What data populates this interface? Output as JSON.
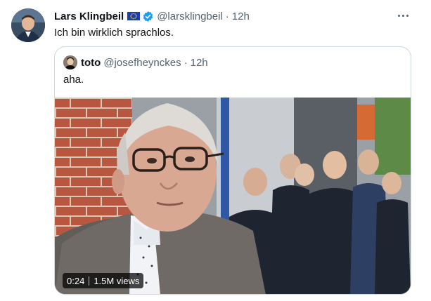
{
  "tweet": {
    "author": {
      "display_name": "Lars Klingbeil",
      "handle": "@larsklingbeil",
      "time": "12h",
      "flag_icon": "eu-flag-icon",
      "verified_icon": "verified-badge-icon",
      "verified_color": "#1d9bf0"
    },
    "separator": "·",
    "text": "Ich bin wirklich sprachlos.",
    "more_icon": "more-icon",
    "quoted": {
      "display_name": "toto",
      "handle": "@josefheynckes",
      "time": "12h",
      "separator": "·",
      "text": "aha.",
      "video": {
        "duration": "0:24",
        "views": "1.5M views"
      }
    }
  },
  "colors": {
    "text_primary": "#0f1419",
    "text_secondary": "#536471",
    "border": "#cfd9de",
    "accent": "#1d9bf0"
  }
}
